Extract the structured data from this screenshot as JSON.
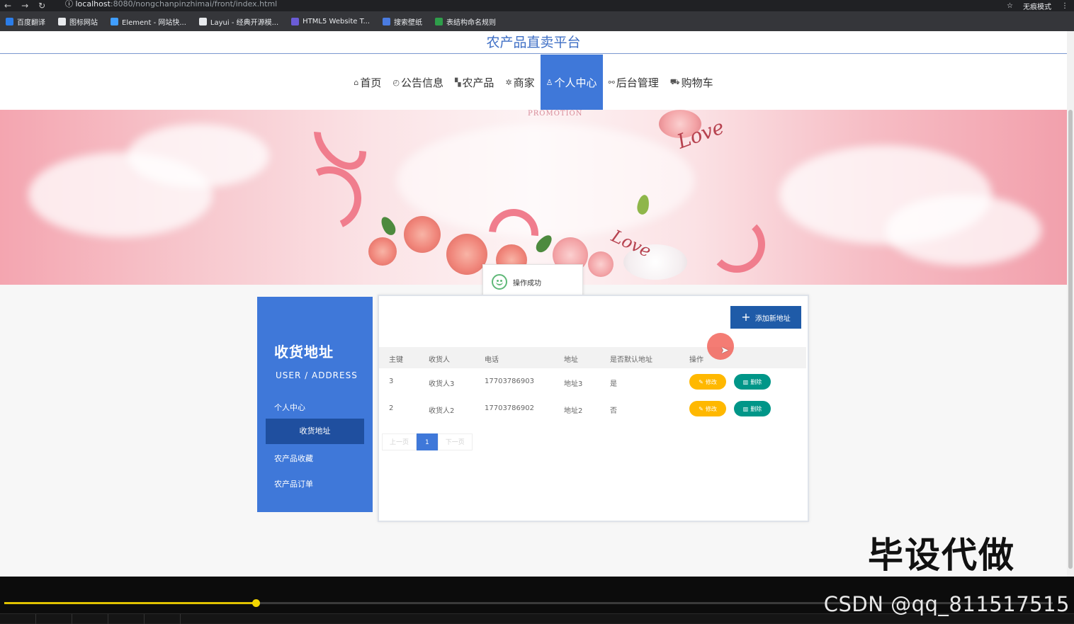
{
  "browser": {
    "url_host": "localhost",
    "url_rest": ":8080/nongchanpinzhimai/front/index.html",
    "incognito_label": "无痕模式",
    "bookmarks": [
      {
        "label": "百度翻译",
        "color": "#2b7de9"
      },
      {
        "label": "图标网站",
        "color": "#e8eaed"
      },
      {
        "label": "Element - 网站快...",
        "color": "#409eff"
      },
      {
        "label": "Layui - 经典开源模...",
        "color": "#e8eaed"
      },
      {
        "label": "HTML5 Website T...",
        "color": "#6b5cd6"
      },
      {
        "label": "搜索壁纸",
        "color": "#4a7be0"
      },
      {
        "label": "表结构命名规则",
        "color": "#2e9e4a"
      }
    ]
  },
  "site": {
    "title": "农产品直卖平台",
    "accent": "#3f78d9"
  },
  "nav": [
    {
      "icon": "home-icon",
      "glyph": "⌂",
      "label": "首页",
      "active": false
    },
    {
      "icon": "clock-icon",
      "glyph": "◴",
      "label": "公告信息",
      "active": false
    },
    {
      "icon": "grid-icon",
      "glyph": "▚",
      "label": "农产品",
      "active": false
    },
    {
      "icon": "settings-icon",
      "glyph": "✲",
      "label": "商家",
      "active": false
    },
    {
      "icon": "user-icon",
      "glyph": "♙",
      "label": "个人中心",
      "active": true
    },
    {
      "icon": "link-icon",
      "glyph": "⚯",
      "label": "后台管理",
      "active": false
    },
    {
      "icon": "cart-icon",
      "glyph": "⛟",
      "label": "购物车",
      "active": false
    }
  ],
  "banner": {
    "promo_text": "PROMOTION",
    "love_text_1": "Love",
    "love_text_2": "Love"
  },
  "toast": {
    "message": "操作成功"
  },
  "sidebar": {
    "title": "收货地址",
    "subtitle": "USER / ADDRESS",
    "items": [
      {
        "label": "个人中心",
        "active": false
      },
      {
        "label": "收货地址",
        "active": true
      },
      {
        "label": "农产品收藏",
        "active": false
      },
      {
        "label": "农产品订单",
        "active": false
      }
    ]
  },
  "content": {
    "add_button": "添加新地址",
    "columns": [
      "主键",
      "收货人",
      "电话",
      "地址",
      "是否默认地址",
      "操作"
    ],
    "rows": [
      {
        "id": "3",
        "name": "收货人3",
        "phone": "17703786903",
        "address": "地址3",
        "default": "是"
      },
      {
        "id": "2",
        "name": "收货人2",
        "phone": "17703786902",
        "address": "地址2",
        "default": "否"
      }
    ],
    "edit_label": "修改",
    "delete_label": "删除",
    "pager": {
      "prev": "上一页",
      "current": "1",
      "next": "下一页"
    }
  },
  "overlay": {
    "watermark": "毕设代做",
    "csdn": "CSDN @qq_811517515"
  },
  "player": {
    "progress": 0.24
  }
}
